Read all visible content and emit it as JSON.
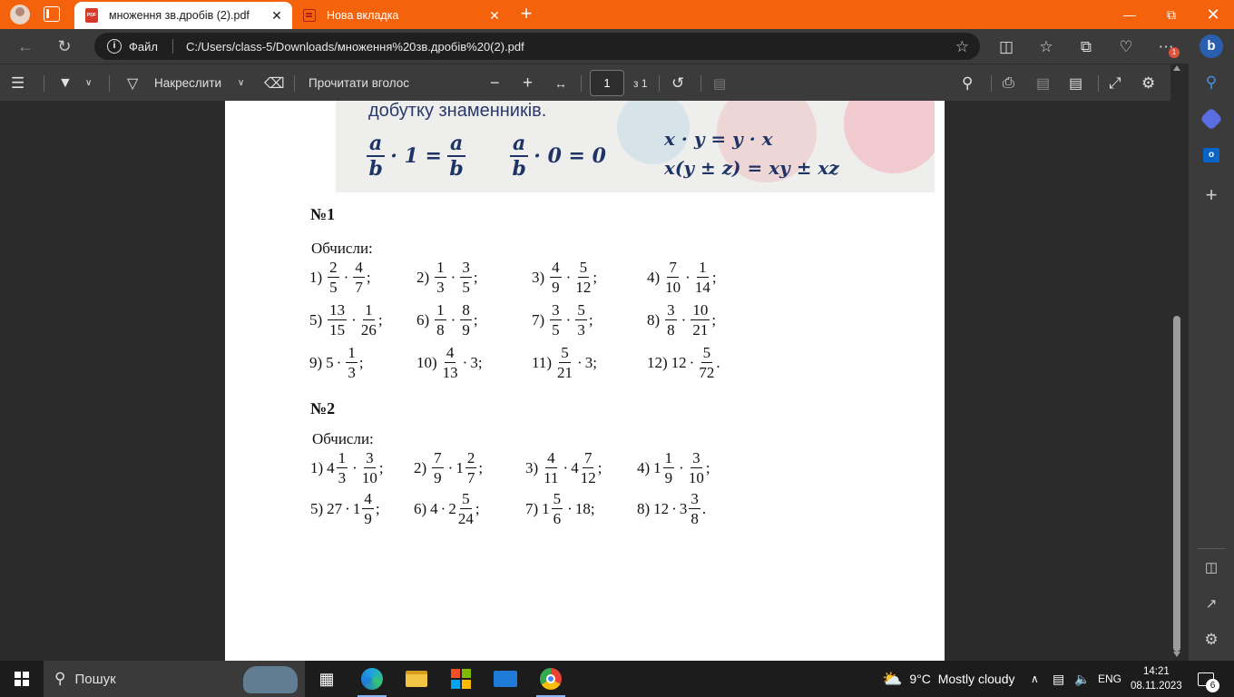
{
  "browser": {
    "tabs": [
      {
        "label": "множення зв.дробів (2).pdf",
        "icon": "pdf-icon",
        "active": true
      },
      {
        "label": "Нова вкладка",
        "icon": "new-tab-page-icon",
        "active": false
      }
    ],
    "address": {
      "scheme": "Файл",
      "url": "C:/Users/class-5/Downloads/множення%20зв.дробів%20(2).pdf"
    },
    "notification_badge": "1"
  },
  "pdf_toolbar": {
    "draw_label": "Накреслити",
    "read_aloud_label": "Прочитати вголос",
    "page_current": "1",
    "page_total": "з 1"
  },
  "document": {
    "banner_text": "добутку знаменників.",
    "formula_1": {
      "n1": "a",
      "d1": "b",
      "mid": "· 1 =",
      "n2": "a",
      "d2": "b"
    },
    "formula_2": {
      "n": "a",
      "d": "b",
      "rest": "· 0 = 0"
    },
    "formula_3": "x · y = y · x",
    "formula_4": "x(y ± z) = xy ± xz",
    "task1": {
      "heading": "№1",
      "instruction": "Обчисли:",
      "items": [
        {
          "label": "1)",
          "parts": [
            {
              "n": "2",
              "d": "5"
            },
            {
              "n": "4",
              "d": "7"
            }
          ],
          "end": ";"
        },
        {
          "label": "2)",
          "parts": [
            {
              "n": "1",
              "d": "3"
            },
            {
              "n": "3",
              "d": "5"
            }
          ],
          "end": ";"
        },
        {
          "label": "3)",
          "parts": [
            {
              "n": "4",
              "d": "9"
            },
            {
              "n": "5",
              "d": "12"
            }
          ],
          "end": ";"
        },
        {
          "label": "4)",
          "parts": [
            {
              "n": "7",
              "d": "10"
            },
            {
              "n": "1",
              "d": "14"
            }
          ],
          "end": ";"
        },
        {
          "label": "5)",
          "parts": [
            {
              "n": "13",
              "d": "15"
            },
            {
              "n": "1",
              "d": "26"
            }
          ],
          "end": ";"
        },
        {
          "label": "6)",
          "parts": [
            {
              "n": "1",
              "d": "8"
            },
            {
              "n": "8",
              "d": "9"
            }
          ],
          "end": ";"
        },
        {
          "label": "7)",
          "parts": [
            {
              "n": "3",
              "d": "5"
            },
            {
              "n": "5",
              "d": "3"
            }
          ],
          "end": ";"
        },
        {
          "label": "8)",
          "parts": [
            {
              "n": "3",
              "d": "8"
            },
            {
              "n": "10",
              "d": "21"
            }
          ],
          "end": ";"
        },
        {
          "label": "9)",
          "parts": [
            {
              "t": "5"
            },
            {
              "n": "1",
              "d": "3"
            }
          ],
          "end": ";"
        },
        {
          "label": "10)",
          "parts": [
            {
              "n": "4",
              "d": "13"
            },
            {
              "t": "3"
            }
          ],
          "end": ";"
        },
        {
          "label": "11)",
          "parts": [
            {
              "n": "5",
              "d": "21"
            },
            {
              "t": "3"
            }
          ],
          "end": ";"
        },
        {
          "label": "12)",
          "parts": [
            {
              "t": "12"
            },
            {
              "n": "5",
              "d": "72"
            }
          ],
          "end": "."
        }
      ]
    },
    "task2": {
      "heading": "№2",
      "instruction": "Обчисли:",
      "items": [
        {
          "label": "1)",
          "parts": [
            {
              "w": "4",
              "n": "1",
              "d": "3"
            },
            {
              "n": "3",
              "d": "10"
            }
          ],
          "end": ";"
        },
        {
          "label": "2)",
          "parts": [
            {
              "n": "7",
              "d": "9"
            },
            {
              "w": "1",
              "n": "2",
              "d": "7"
            }
          ],
          "end": ";"
        },
        {
          "label": "3)",
          "parts": [
            {
              "n": "4",
              "d": "11"
            },
            {
              "w": "4",
              "n": "7",
              "d": "12"
            }
          ],
          "end": ";"
        },
        {
          "label": "4)",
          "parts": [
            {
              "w": "1",
              "n": "1",
              "d": "9"
            },
            {
              "n": "3",
              "d": "10"
            }
          ],
          "end": ";"
        },
        {
          "label": "5)",
          "parts": [
            {
              "t": "27"
            },
            {
              "w": "1",
              "n": "4",
              "d": "9"
            }
          ],
          "end": ";"
        },
        {
          "label": "6)",
          "parts": [
            {
              "t": "4"
            },
            {
              "w": "2",
              "n": "5",
              "d": "24"
            }
          ],
          "end": ";"
        },
        {
          "label": "7)",
          "parts": [
            {
              "w": "1",
              "n": "5",
              "d": "6"
            },
            {
              "t": "18"
            }
          ],
          "end": ";"
        },
        {
          "label": "8)",
          "parts": [
            {
              "t": "12"
            },
            {
              "w": "3",
              "n": "3",
              "d": "8"
            }
          ],
          "end": "."
        }
      ]
    }
  },
  "taskbar": {
    "search_label": "Пошук",
    "weather": "9°C  Mostly cloudy",
    "language": "ENG",
    "time": "14:21",
    "date": "08.11.2023",
    "notifications": "6"
  }
}
